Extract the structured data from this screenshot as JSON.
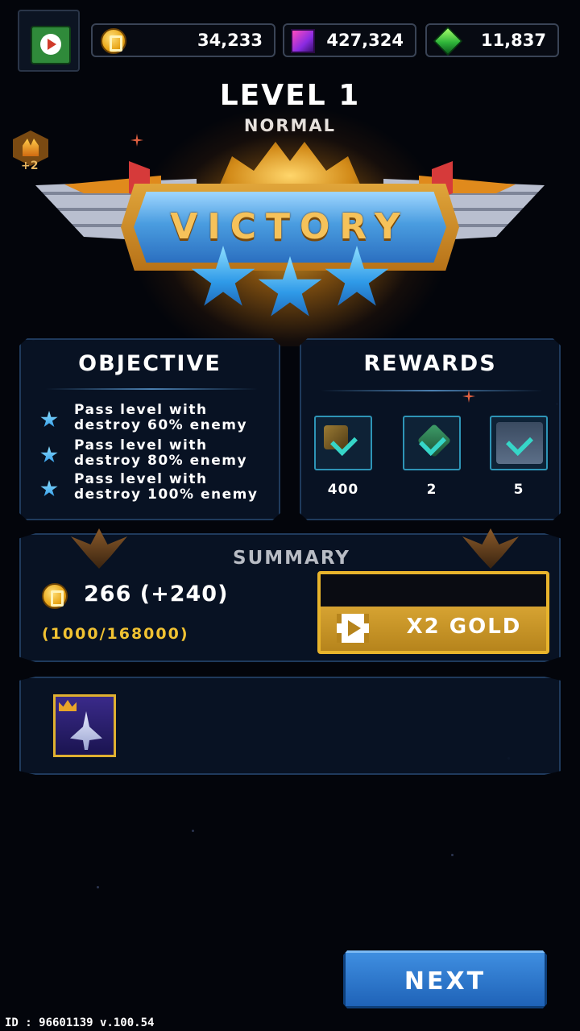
{
  "currencies": {
    "gold": "34,233",
    "crystal": "427,324",
    "gem": "11,837"
  },
  "header": {
    "level": "LEVEL 1",
    "difficulty": "NORMAL",
    "side_badge_count": "+2",
    "banner": "VICTORY",
    "stars_earned": 3
  },
  "objective": {
    "title": "OBJECTIVE",
    "items": [
      "Pass level with destroy 60% enemy",
      "Pass level with destroy 80% enemy",
      "Pass level with destroy 100% enemy"
    ]
  },
  "rewards": {
    "title": "REWARDS",
    "items": [
      {
        "value": "400",
        "icon": "chip-reward-icon"
      },
      {
        "value": "2",
        "icon": "green-card-reward-icon"
      },
      {
        "value": "5",
        "icon": "ship-card-reward-icon"
      }
    ]
  },
  "summary": {
    "title": "SUMMARY",
    "gold_earned": "266 (+240)",
    "gold_progress": "(1000/168000)",
    "x2_button": "X2 GOLD"
  },
  "next_button": "NEXT",
  "footer_id": "ID : 96601139 v.100.54"
}
